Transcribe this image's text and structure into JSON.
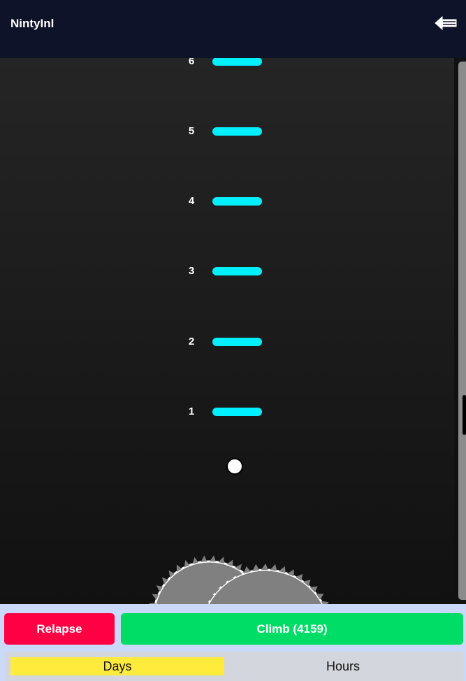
{
  "header": {
    "title": "NintyInl",
    "back_icon": "back-arrow-icon"
  },
  "game": {
    "rungs": [
      {
        "label": "6"
      },
      {
        "label": "5"
      },
      {
        "label": "4"
      },
      {
        "label": "3"
      },
      {
        "label": "2"
      },
      {
        "label": "1"
      }
    ],
    "rung_color": "#00f0ff",
    "hazard_icon": "circular-saw-icon"
  },
  "controls": {
    "relapse_label": "Relapse",
    "climb_label": "Climb (4159)",
    "relapse_color": "#ff0044",
    "climb_color": "#00dd66"
  },
  "unit_toggle": {
    "options": [
      "Days",
      "Hours"
    ],
    "selected": "Days",
    "selected_color": "#ffeb3b"
  }
}
